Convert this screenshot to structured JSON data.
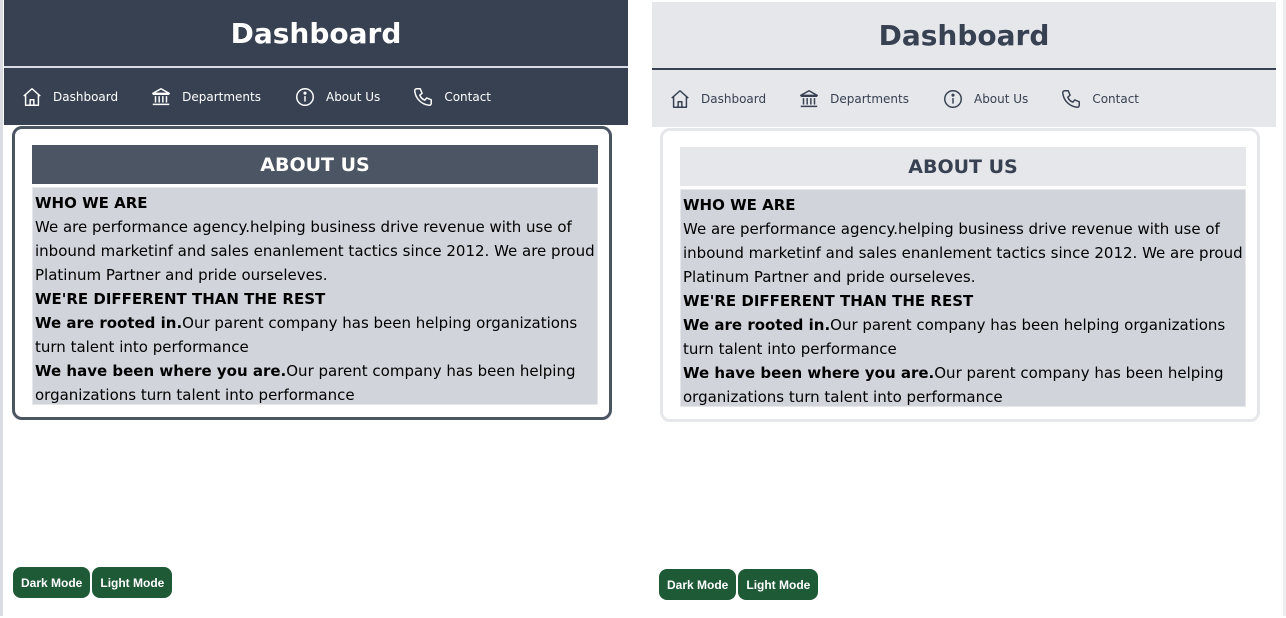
{
  "panes": [
    {
      "mode": "dark",
      "header": {
        "title": "Dashboard"
      },
      "nav": {
        "items": [
          "Dashboard",
          "Departments",
          "About Us",
          "Contact"
        ]
      },
      "card": {
        "title": "ABOUT US",
        "who_heading": "WHO WE ARE",
        "who_text": "We are performance agency.helping business drive revenue with use of inbound marketinf and sales enanlement tactics since 2012. We are proud Platinum Partner and pride ourseleves.",
        "diff_heading": "WE'RE DIFFERENT THAN THE REST",
        "rooted_bold": "We are rooted in.",
        "rooted_text": "Our parent company has been helping organizations turn talent into performance",
        "been_bold": "We have been where you are.",
        "been_text": "Our parent company has been helping organizations turn talent into performance"
      },
      "buttons": {
        "dark": "Dark Mode",
        "light": "Light Mode"
      }
    },
    {
      "mode": "light",
      "header": {
        "title": "Dashboard"
      },
      "nav": {
        "items": [
          "Dashboard",
          "Departments",
          "About Us",
          "Contact"
        ]
      },
      "card": {
        "title": "ABOUT US",
        "who_heading": "WHO WE ARE",
        "who_text": "We are performance agency.helping business drive revenue with use of inbound marketinf and sales enanlement tactics since 2012. We are proud Platinum Partner and pride ourseleves.",
        "diff_heading": "WE'RE DIFFERENT THAN THE REST",
        "rooted_bold": "We are rooted in.",
        "rooted_text": "Our parent company has been helping organizations turn talent into performance",
        "been_bold": "We have been where you are.",
        "been_text": "Our parent company has been helping organizations turn talent into performance"
      },
      "buttons": {
        "dark": "Dark Mode",
        "light": "Light Mode"
      }
    }
  ],
  "icons": [
    "home-icon",
    "bank-icon",
    "info-icon",
    "phone-icon"
  ],
  "colors": {
    "dark_header": "#374151",
    "dark_card_title": "#4b5563",
    "light_header": "#e5e7eb",
    "card_body": "#d1d5db",
    "button": "#1f5a37"
  }
}
